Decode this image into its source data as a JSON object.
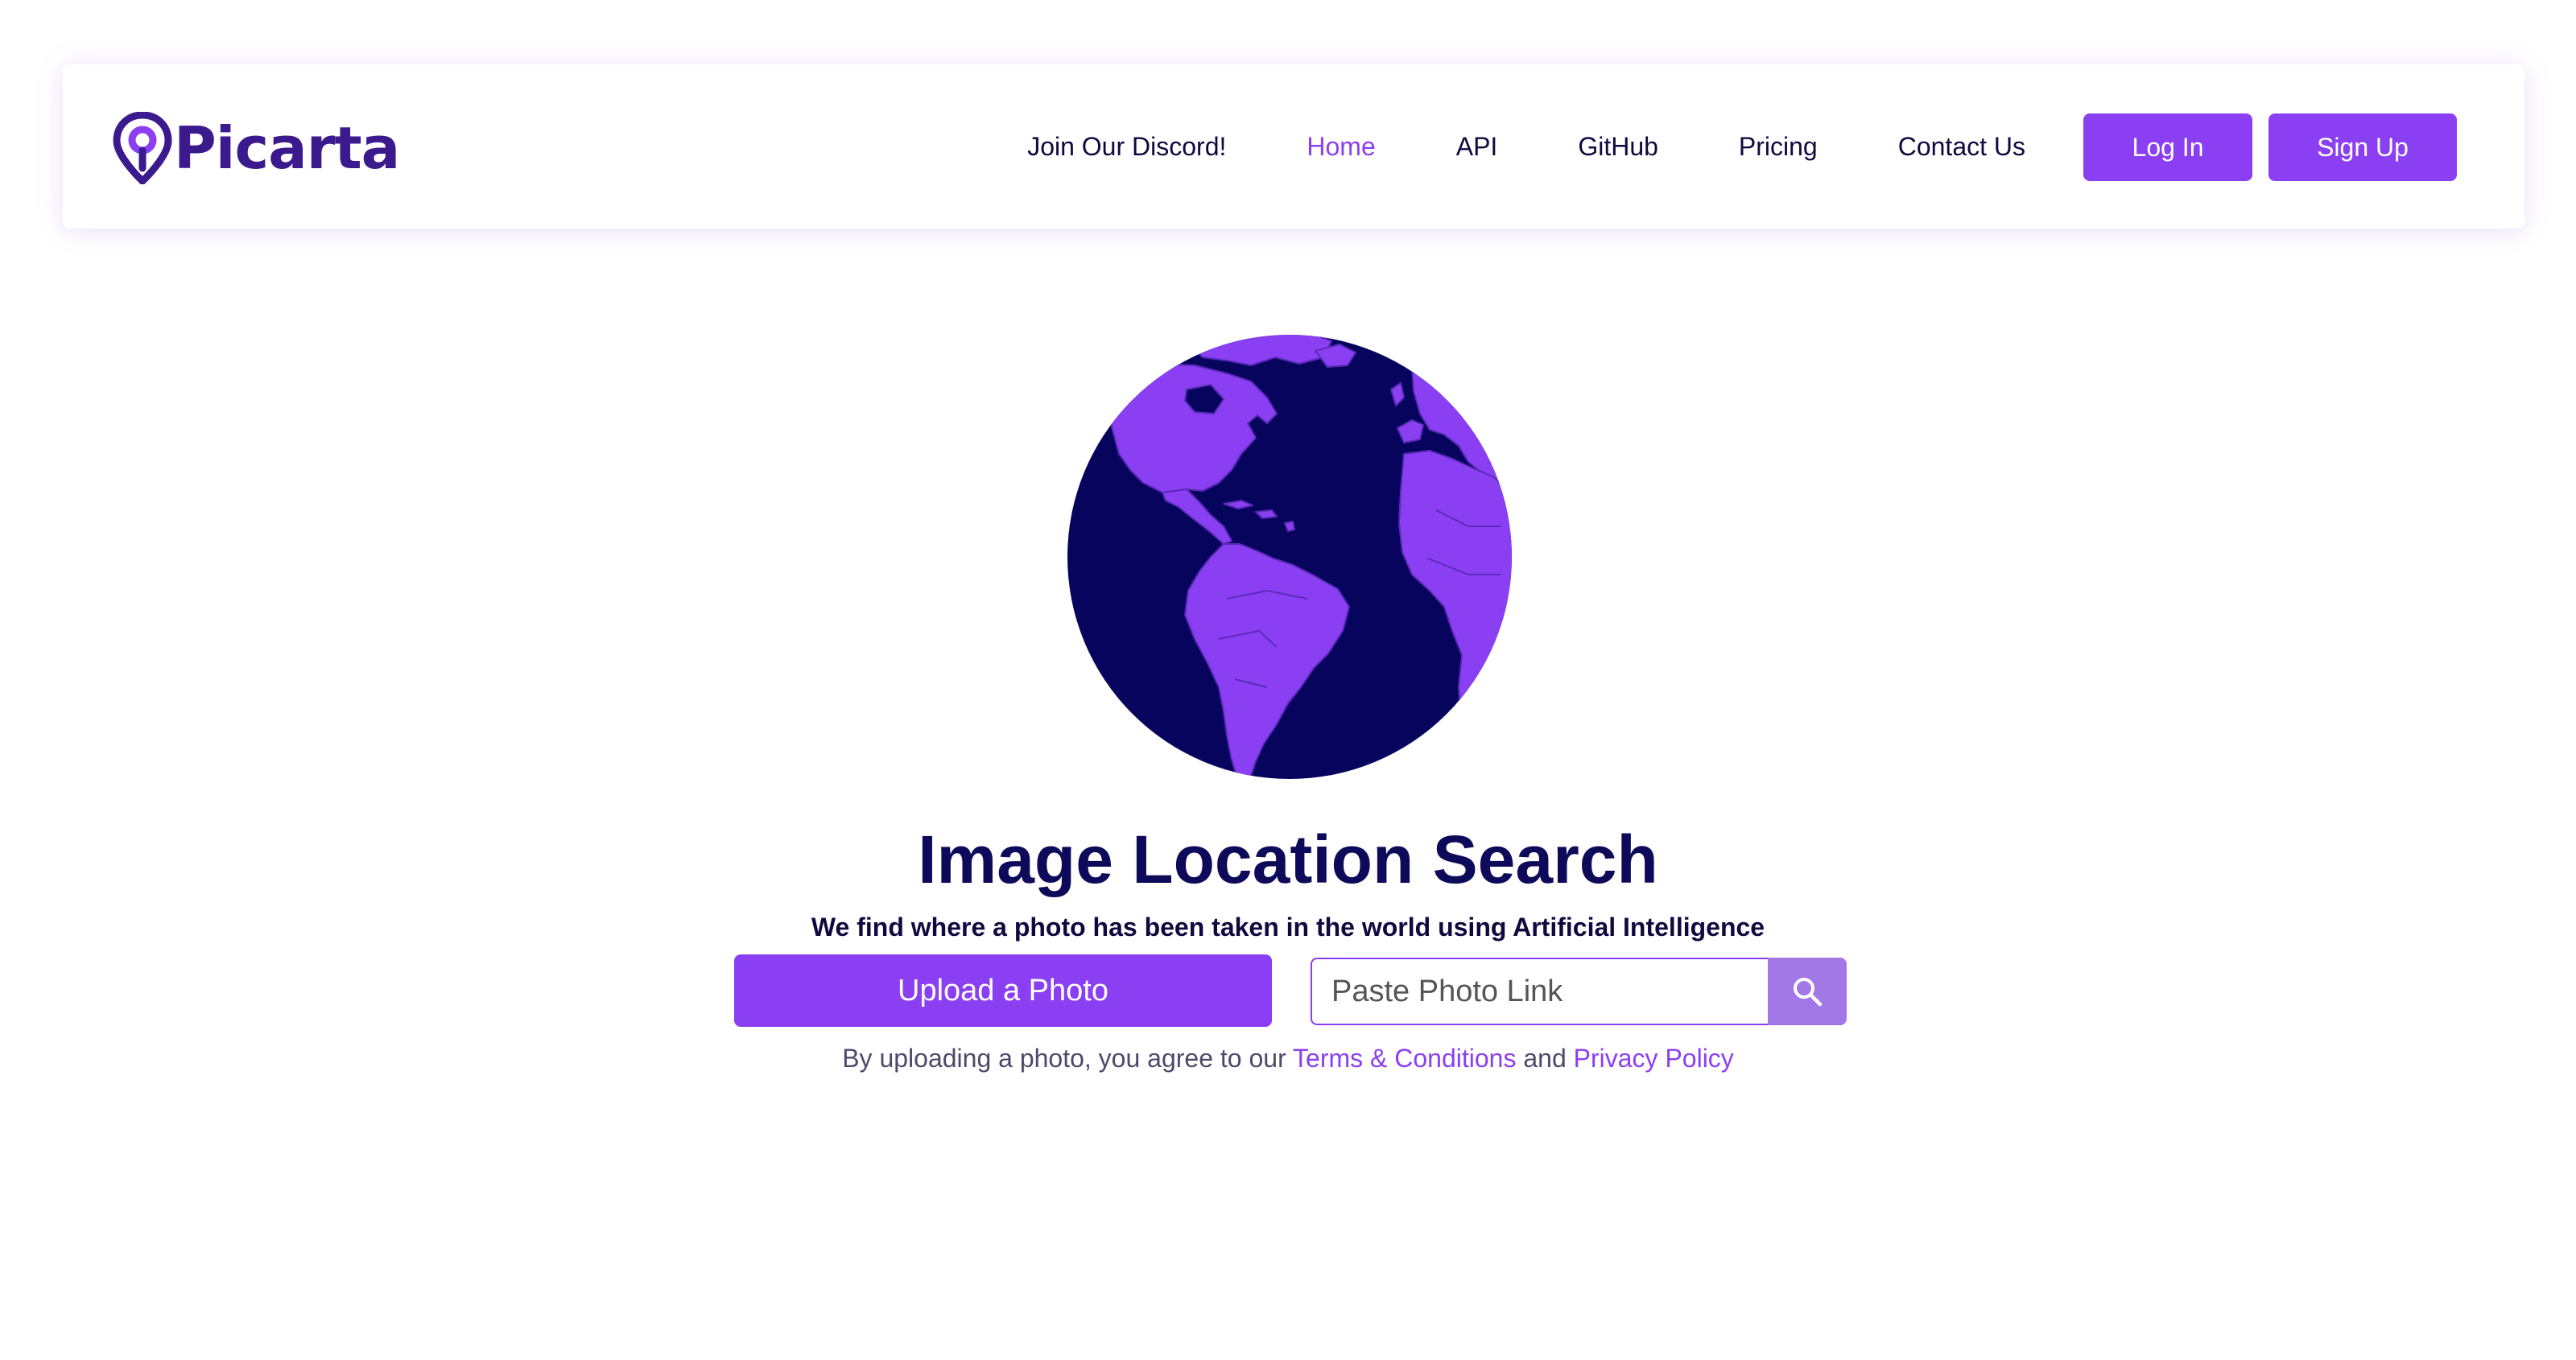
{
  "brand": {
    "name": "Picarta",
    "color": "#3a1a8c",
    "logo_icon": "location-pin-icon"
  },
  "nav": {
    "links": [
      {
        "label": "Join Our Discord!",
        "active": false
      },
      {
        "label": "Home",
        "active": true
      },
      {
        "label": "API",
        "active": false
      },
      {
        "label": "GitHub",
        "active": false
      },
      {
        "label": "Pricing",
        "active": false
      },
      {
        "label": "Contact Us",
        "active": false
      }
    ],
    "login_label": "Log In",
    "signup_label": "Sign Up"
  },
  "hero": {
    "globe_icon": "globe-icon",
    "title": "Image Location Search",
    "subtitle": "We find where a photo has been taken in the world using Artificial Intelligence",
    "upload_label": "Upload a Photo",
    "link_placeholder": "Paste Photo Link",
    "search_icon": "search-icon",
    "agreement": {
      "prefix": "By uploading a photo, you agree to our",
      "terms_label": "Terms & Conditions",
      "conjunction": "and",
      "privacy_label": "Privacy Policy"
    }
  },
  "colors": {
    "accent": "#8b3ff2",
    "dark_navy": "#0e0a5a",
    "globe_ocean": "#07045e",
    "globe_land": "#8b3ff2",
    "search_button": "#a277e6"
  }
}
